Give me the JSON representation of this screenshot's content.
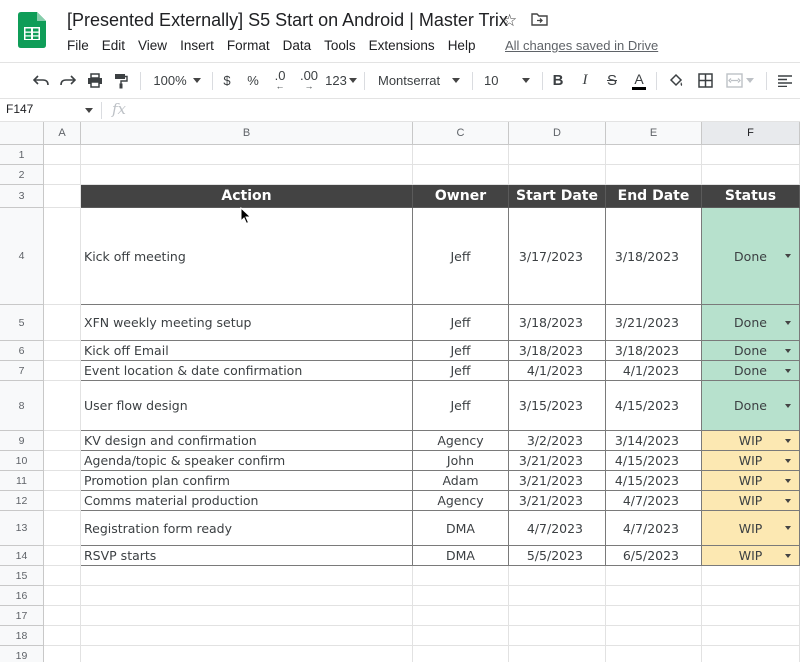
{
  "doc": {
    "title": "[Presented Externally] S5 Start on Android | Master Trix",
    "saved_status": "All changes saved in Drive"
  },
  "menu": [
    "File",
    "Edit",
    "View",
    "Insert",
    "Format",
    "Data",
    "Tools",
    "Extensions",
    "Help"
  ],
  "toolbar": {
    "zoom": "100%",
    "currency": "$",
    "percent": "%",
    "decimal_less": ".0",
    "decimal_more": ".00",
    "more_formats": "123",
    "font": "Montserrat",
    "font_size": "10",
    "bold": "B",
    "italic": "I",
    "strikethrough": "S",
    "text_color_letter": "A"
  },
  "name_box": "F147",
  "fx": "fx",
  "columns": [
    "A",
    "B",
    "C",
    "D",
    "E",
    "F"
  ],
  "row_numbers": [
    "1",
    "2",
    "3",
    "4",
    "5",
    "6",
    "7",
    "8",
    "9",
    "10",
    "11",
    "12",
    "13",
    "14",
    "15",
    "16",
    "17",
    "18",
    "19"
  ],
  "table": {
    "headers": [
      "Action",
      "Owner",
      "Start Date",
      "End Date",
      "Status"
    ],
    "rows": [
      {
        "action": "Kick off meeting",
        "owner": "Jeff",
        "start": "3/17/2023",
        "end": "3/18/2023",
        "status": "Done"
      },
      {
        "action": "XFN weekly meeting setup",
        "owner": "Jeff",
        "start": "3/18/2023",
        "end": "3/21/2023",
        "status": "Done"
      },
      {
        "action": "Kick off Email",
        "owner": "Jeff",
        "start": "3/18/2023",
        "end": "3/18/2023",
        "status": "Done"
      },
      {
        "action": "Event location & date confirmation",
        "owner": "Jeff",
        "start": "4/1/2023",
        "end": "4/1/2023",
        "status": "Done"
      },
      {
        "action": "User flow design",
        "owner": "Jeff",
        "start": "3/15/2023",
        "end": "4/15/2023",
        "status": "Done"
      },
      {
        "action": "KV design and confirmation",
        "owner": "Agency",
        "start": "3/2/2023",
        "end": "3/14/2023",
        "status": "WIP"
      },
      {
        "action": "Agenda/topic & speaker confirm",
        "owner": "John",
        "start": "3/21/2023",
        "end": "4/15/2023",
        "status": "WIP"
      },
      {
        "action": "Promotion plan confirm",
        "owner": "Adam",
        "start": "3/21/2023",
        "end": "4/15/2023",
        "status": "WIP"
      },
      {
        "action": "Comms material production",
        "owner": "Agency",
        "start": "3/21/2023",
        "end": "4/7/2023",
        "status": "WIP"
      },
      {
        "action": "Registration form ready",
        "owner": "DMA",
        "start": "4/7/2023",
        "end": "4/7/2023",
        "status": "WIP"
      },
      {
        "action": "RSVP starts",
        "owner": "DMA",
        "start": "5/5/2023",
        "end": "6/5/2023",
        "status": "WIP"
      }
    ]
  },
  "colors": {
    "header_bg": "#434343",
    "done_bg": "#b7e1cd",
    "wip_bg": "#fce8b2",
    "sheets_green": "#0f9d58"
  }
}
